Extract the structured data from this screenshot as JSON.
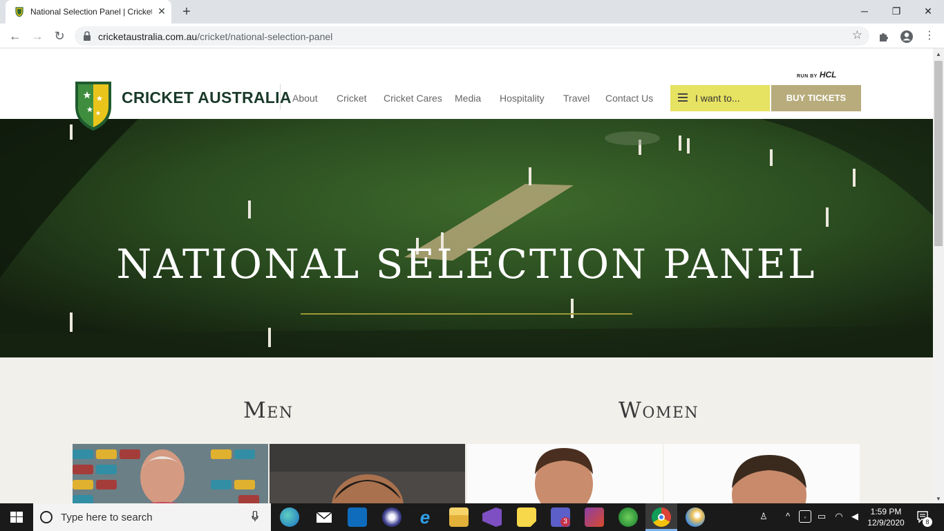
{
  "browser": {
    "tab_title": "National Selection Panel | Cricket",
    "tab_close": "✕",
    "new_tab": "+",
    "window_controls": {
      "minimize": "─",
      "maximize": "❐",
      "close": "✕"
    },
    "url_domain": "cricketaustralia.com.au",
    "url_path": "/cricket/national-selection-panel"
  },
  "site": {
    "logo_text": "CRICKET AUSTRALIA",
    "run_by_label": "RUN BY",
    "run_by_brand": "HCL",
    "nav": [
      "About",
      "Cricket",
      "Cricket Cares",
      "Media",
      "Hospitality",
      "Travel",
      "Contact Us"
    ],
    "i_want_to": "I want to...",
    "buy_tickets": "BUY TICKETS",
    "hero_title": "NATIONAL SELECTION PANEL",
    "sections": {
      "men": "Men",
      "women": "Women"
    },
    "colors": {
      "accent_yellow": "#e6e262",
      "tickets_gold": "#b8ac7c",
      "hero_line": "#9b9a35",
      "logo_green": "#1a3a2a"
    }
  },
  "taskbar": {
    "search_placeholder": "Type here to search",
    "time": "1:59 PM",
    "date": "12/9/2020",
    "notification_count": "8",
    "teams_badge": "3",
    "apps": [
      "edge-icon",
      "mail-icon",
      "outlook-icon",
      "eclipse-icon",
      "internet-explorer-icon",
      "file-explorer-icon",
      "visual-studio-icon",
      "sticky-notes-icon",
      "teams-icon",
      "game-icon",
      "xbox-icon",
      "chrome-icon",
      "paint-icon"
    ]
  }
}
